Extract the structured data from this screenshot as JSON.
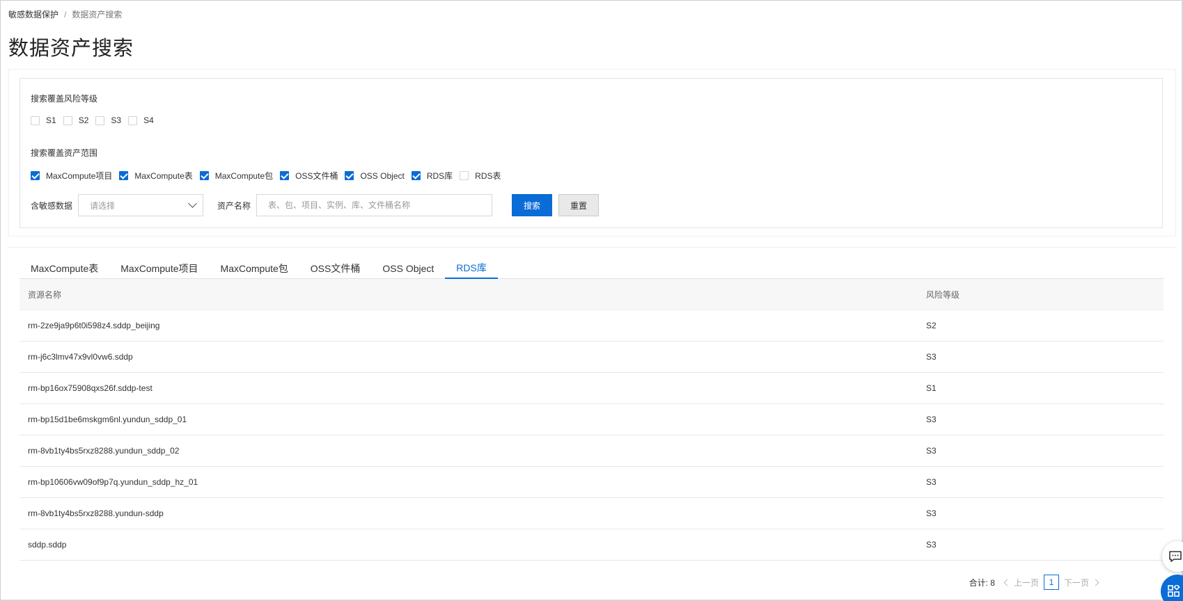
{
  "breadcrumb": {
    "parent": "敏感数据保护",
    "separator": "/",
    "current": "数据资产搜索"
  },
  "page_title": "数据资产搜索",
  "filters": {
    "risk_level_label": "搜索覆盖风险等级",
    "risk_levels": [
      {
        "label": "S1",
        "checked": false
      },
      {
        "label": "S2",
        "checked": false
      },
      {
        "label": "S3",
        "checked": false
      },
      {
        "label": "S4",
        "checked": false
      }
    ],
    "asset_scope_label": "搜索覆盖资产范围",
    "asset_scopes": [
      {
        "label": "MaxCompute项目",
        "checked": true
      },
      {
        "label": "MaxCompute表",
        "checked": true
      },
      {
        "label": "MaxCompute包",
        "checked": true
      },
      {
        "label": "OSS文件桶",
        "checked": true
      },
      {
        "label": "OSS Object",
        "checked": true
      },
      {
        "label": "RDS库",
        "checked": true
      },
      {
        "label": "RDS表",
        "checked": false
      }
    ],
    "sensitive_label": "含敏感数据",
    "sensitive_placeholder": "请选择",
    "asset_name_label": "资产名称",
    "asset_name_placeholder": "表、包、项目、实例、库、文件桶名称",
    "search_button": "搜索",
    "reset_button": "重置"
  },
  "tabs": [
    {
      "label": "MaxCompute表",
      "active": false
    },
    {
      "label": "MaxCompute项目",
      "active": false
    },
    {
      "label": "MaxCompute包",
      "active": false
    },
    {
      "label": "OSS文件桶",
      "active": false
    },
    {
      "label": "OSS Object",
      "active": false
    },
    {
      "label": "RDS库",
      "active": true
    }
  ],
  "table": {
    "headers": {
      "name": "资源名称",
      "risk": "风险等级"
    },
    "rows": [
      {
        "name": "rm-2ze9ja9p6t0i598z4.sddp_beijing",
        "risk": "S2"
      },
      {
        "name": "rm-j6c3lmv47x9vl0vw6.sddp",
        "risk": "S3"
      },
      {
        "name": "rm-bp16ox75908qxs26f.sddp-test",
        "risk": "S1"
      },
      {
        "name": "rm-bp15d1be6mskgm6nl.yundun_sddp_01",
        "risk": "S3"
      },
      {
        "name": "rm-8vb1ty4bs5rxz8288.yundun_sddp_02",
        "risk": "S3"
      },
      {
        "name": "rm-bp10606vw09of9p7q.yundun_sddp_hz_01",
        "risk": "S3"
      },
      {
        "name": "rm-8vb1ty4bs5rxz8288.yundun-sddp",
        "risk": "S3"
      },
      {
        "name": "sddp.sddp",
        "risk": "S3"
      }
    ]
  },
  "pagination": {
    "total": "合计: 8",
    "prev": "上一页",
    "current_page": "1",
    "next": "下一页"
  },
  "colors": {
    "accent": "#0a6cd6"
  },
  "icons": {
    "chat": "chat-icon",
    "apps": "apps-grid-icon"
  }
}
